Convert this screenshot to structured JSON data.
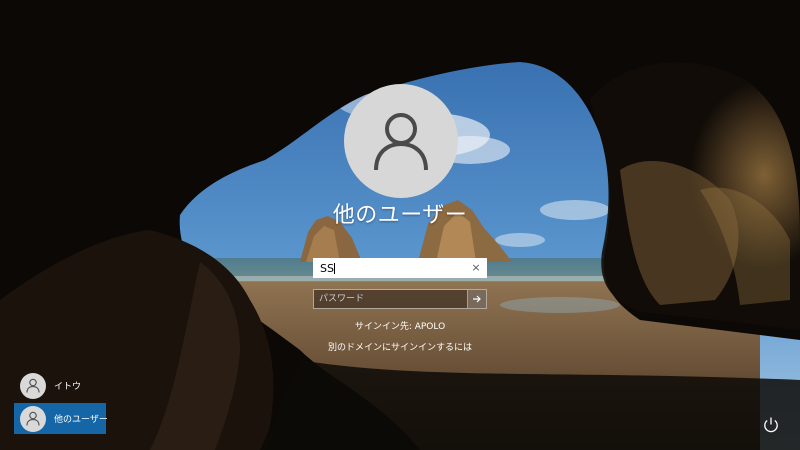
{
  "login": {
    "username": "他のユーザー",
    "username_field_value": "SS",
    "password_placeholder": "パスワード",
    "clear_glyph": "×",
    "sign_in_to": "サインイン先: APOLO",
    "other_domain_link": "別のドメインにサインインするには"
  },
  "user_list": {
    "items": [
      {
        "label": "イトウ",
        "selected": false
      },
      {
        "label": "他のユーザー",
        "selected": true
      }
    ]
  },
  "icons": {
    "avatar": "user-silhouette-icon",
    "submit": "arrow-right-icon",
    "clear": "close-icon",
    "power": "power-icon"
  },
  "colors": {
    "selected_user_bg": "#1466a6",
    "avatar_bg": "#d7d7d7",
    "avatar_glyph": "#4a4a4a"
  }
}
